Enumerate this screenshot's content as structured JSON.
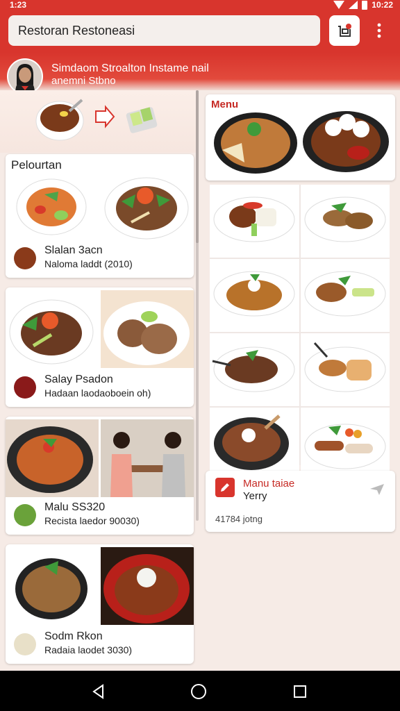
{
  "status": {
    "time_left": "1:23",
    "time_right": "10:22"
  },
  "header": {
    "search_text": "Restoran Restoneasi"
  },
  "profile": {
    "line1": "Simdaom Stroalton Instame nail",
    "line2": "anemni Stbno"
  },
  "left": {
    "section_title": "Pelourtan",
    "cards": [
      {
        "name": "Slalan 3acn",
        "info": "Naloma laddt (2010)"
      },
      {
        "name": "Salay Psadon",
        "info": "Hadaan laodaoboein oh)"
      },
      {
        "name": "Malu SS320",
        "info": "Recista laedor 90030)"
      },
      {
        "name": "Sodm Rkon",
        "info": "Radaia laodet 3030)"
      }
    ]
  },
  "right": {
    "menu_title": "Menu",
    "order": {
      "title": "Manu taiae",
      "subtitle": "Yerry",
      "meta": "41784 jotng"
    }
  },
  "colors": {
    "brand": "#d8352d",
    "accent_text": "#c62a24"
  }
}
